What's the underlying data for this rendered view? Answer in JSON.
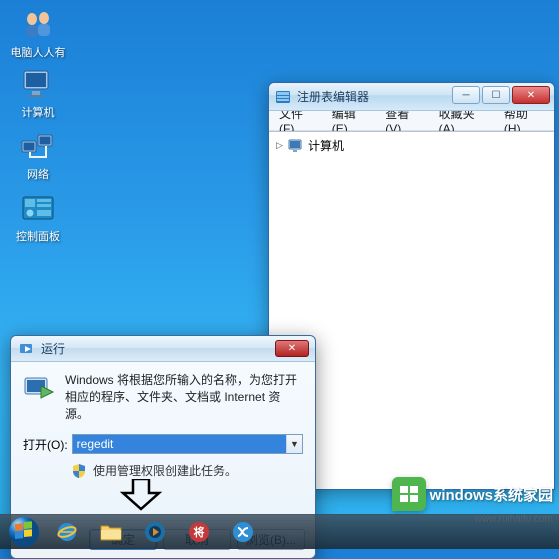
{
  "desktop": {
    "icons": [
      {
        "label": "电脑人人有"
      },
      {
        "label": "计算机"
      },
      {
        "label": "网络"
      },
      {
        "label": "控制面板"
      }
    ]
  },
  "regedit": {
    "title": "注册表编辑器",
    "menu": {
      "file": "文件(F)",
      "edit": "编辑(E)",
      "view": "查看(V)",
      "favorites": "收藏夹(A)",
      "help": "帮助(H)"
    },
    "tree_root": "计算机",
    "win_min": "─",
    "win_max": "☐",
    "win_close": "✕"
  },
  "run": {
    "title": "运行",
    "close": "✕",
    "description": "Windows 将根据您所输入的名称，为您打开相应的程序、文件夹、文档或 Internet 资源。",
    "open_label": "打开(O):",
    "value": "regedit",
    "shield_text": "使用管理权限创建此任务。",
    "ok": "确定",
    "cancel": "取消",
    "browse": "浏览(B)..."
  },
  "watermark": {
    "text": "windows系统家园",
    "url": "www.ruihaifu.com"
  }
}
